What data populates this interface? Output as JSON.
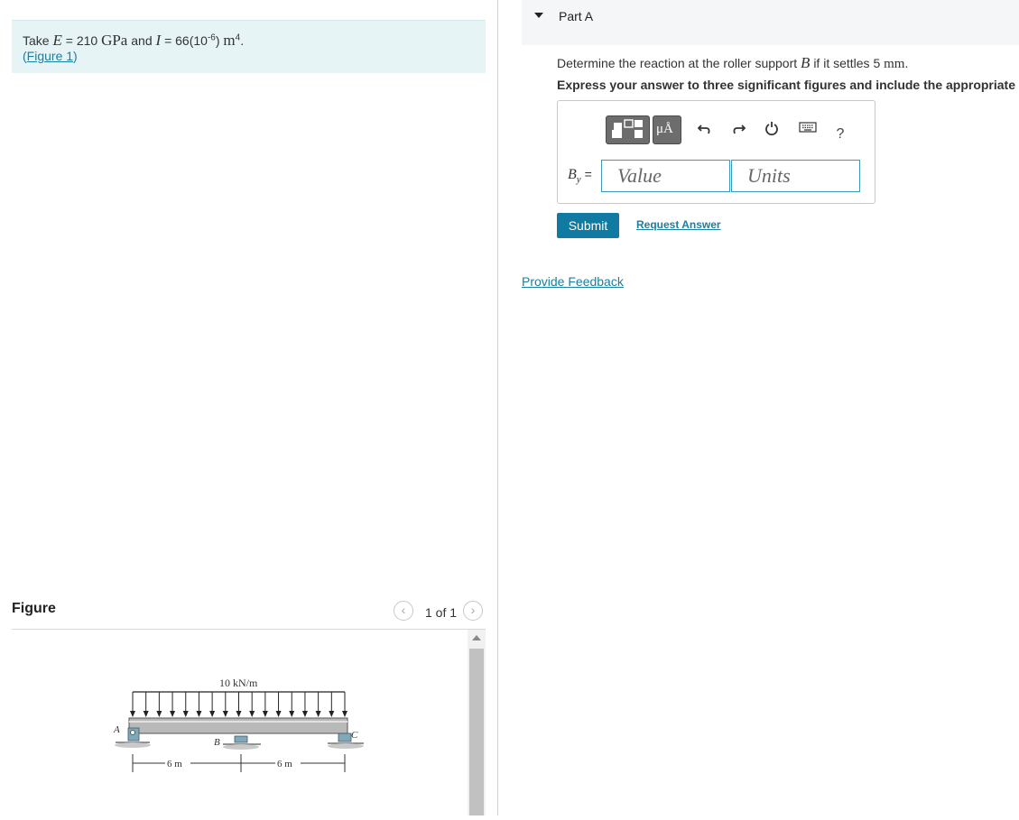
{
  "problem": {
    "take": "Take",
    "E_symbol": "E",
    "E_value": "= 210",
    "E_unit": "GPa",
    "and": "and",
    "I_symbol": "I",
    "I_value": "= 66(10",
    "I_exp": "-6",
    "I_close": ")",
    "I_unit": "m",
    "I_unit_exp": "4",
    "period": ".",
    "figure_link": "Figure 1",
    "paren_open": "(",
    "paren_close": ")"
  },
  "figure_panel": {
    "title": "Figure",
    "prev_icon": "chevron-left-icon",
    "next_icon": "chevron-right-icon",
    "counter": "1 of 1",
    "figure": {
      "load_label": "10 kN/m",
      "label_A": "A",
      "label_B": "B",
      "label_C": "C",
      "span1": "6 m",
      "span2": "6 m"
    }
  },
  "part": {
    "title": "Part A",
    "question_pre": "Determine the reaction at the roller support",
    "question_symbol": "B",
    "question_post": "if it settles 5",
    "question_unit": "mm",
    "question_end": ".",
    "instruction": "Express your answer to three significant figures and include the appropriate units."
  },
  "answer": {
    "label_symbol": "B",
    "label_sub": "y",
    "label_eq": "=",
    "value_placeholder": "Value",
    "units_placeholder": "Units",
    "toolbar": {
      "templates_icon": "templates-icon",
      "units_icon": "units-icon",
      "units_glyph": "μÅ",
      "undo_icon": "undo-icon",
      "redo_icon": "redo-icon",
      "reset_icon": "reset-icon",
      "keyboard_icon": "keyboard-icon",
      "help_glyph": "?"
    }
  },
  "actions": {
    "submit": "Submit",
    "request_answer": "Request Answer",
    "provide_feedback": "Provide Feedback"
  },
  "colors": {
    "problem_bg": "#e6f4f6",
    "link": "#1a7fa0",
    "submit_bg": "#107aa3",
    "field_border": "#3a9ab8"
  }
}
